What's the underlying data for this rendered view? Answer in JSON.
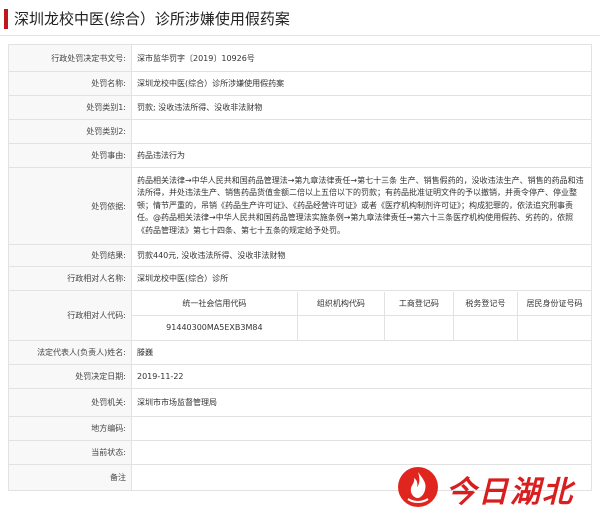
{
  "page": {
    "title": "深圳龙校中医(综合）诊所涉嫌使用假药案"
  },
  "rows": [
    {
      "label": "行政处罚决定书文号:",
      "value": "深市监华罚字〔2019〕10926号"
    },
    {
      "label": "处罚名称:",
      "value": "深圳龙校中医(综合）诊所涉嫌使用假药案"
    },
    {
      "label": "处罚类别1:",
      "value": "罚款; 没收违法所得、没收非法财物"
    },
    {
      "label": "处罚类别2:",
      "value": ""
    },
    {
      "label": "处罚事由:",
      "value": "药品违法行为"
    },
    {
      "label": "处罚依据:",
      "value": "药品相关法律→中华人民共和国药品管理法→第九章法律责任→第七十三条 生产、销售假药的，没收违法生产、销售的药品和违法所得，并处违法生产、销售药品货值金额二倍以上五倍以下的罚款；有药品批准证明文件的予以撤销，并责令停产、停业整顿；情节严重的，吊销《药品生产许可证》、《药品经营许可证》或者《医疗机构制剂许可证》；构成犯罪的，依法追究刑事责任。@药品相关法律→中华人民共和国药品管理法实施条例→第九章法律责任→第六十三条医疗机构使用假药、劣药的，依照《药品管理法》第七十四条、第七十五条的规定给予处罚。"
    },
    {
      "label": "处罚结果:",
      "value": "罚款440元, 没收违法所得、没收非法财物"
    },
    {
      "label": "行政相对人名称:",
      "value": "深圳龙校中医(综合）诊所"
    }
  ],
  "codes": {
    "label": "行政相对人代码:",
    "headers": [
      "统一社会信用代码",
      "组织机构代码",
      "工商登记码",
      "税务登记号",
      "居民身份证号码"
    ],
    "values": [
      "91440300MA5EXB3M84",
      "",
      "",
      "",
      ""
    ]
  },
  "rows2": [
    {
      "label": "法定代表人(负责人)姓名:",
      "value": "滕巍"
    },
    {
      "label": "处罚决定日期:",
      "value": "2019-11-22"
    },
    {
      "label": "处罚机关:",
      "value": "深圳市市场监督管理局"
    },
    {
      "label": "地方编码:",
      "value": ""
    },
    {
      "label": "当前状态:",
      "value": ""
    },
    {
      "label": "备注",
      "value": ""
    }
  ],
  "watermark": {
    "text": "今日湖北",
    "color": "#d81e1e",
    "icon": "flame-logo-icon"
  }
}
